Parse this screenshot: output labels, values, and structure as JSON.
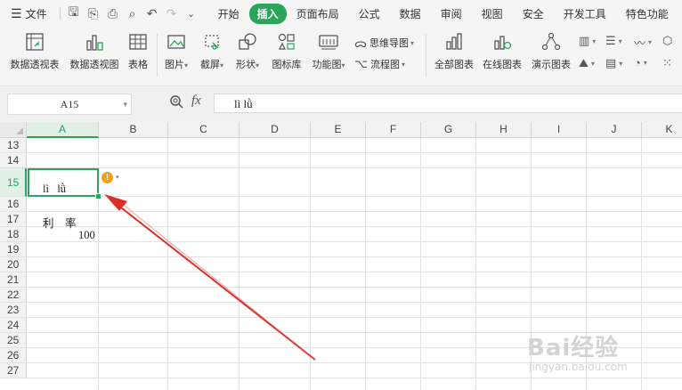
{
  "menu": {
    "file_label": "文件",
    "tabs": [
      {
        "label": "开始",
        "active": false
      },
      {
        "label": "插入",
        "active": true
      },
      {
        "label": "页面布局",
        "active": false
      },
      {
        "label": "公式",
        "active": false
      },
      {
        "label": "数据",
        "active": false
      },
      {
        "label": "审阅",
        "active": false
      },
      {
        "label": "视图",
        "active": false
      },
      {
        "label": "安全",
        "active": false
      },
      {
        "label": "开发工具",
        "active": false
      },
      {
        "label": "特色功能",
        "active": false
      }
    ]
  },
  "ribbon": {
    "pivot_table": "数据透视表",
    "pivot_chart": "数据透视图",
    "table": "表格",
    "picture": "图片",
    "screenshot": "截屏",
    "shape": "形状",
    "icon_lib": "图标库",
    "function_chart": "功能图",
    "mind_map": "思维导图",
    "flow_chart": "流程图",
    "all_charts": "全部图表",
    "online_chart": "在线图表",
    "demo_chart": "演示图表"
  },
  "formula_bar": {
    "name_box": "A15",
    "fx_label": "fx",
    "content": "lì   lǜ"
  },
  "sheet": {
    "columns": [
      "A",
      "B",
      "C",
      "D",
      "E",
      "F",
      "G",
      "H",
      "I",
      "J",
      "K"
    ],
    "selected_column": "A",
    "rows": [
      "13",
      "14",
      "15",
      "16",
      "17",
      "18",
      "19",
      "20",
      "21",
      "22",
      "23",
      "24",
      "25",
      "26",
      "27"
    ],
    "selected_row": "15",
    "cells": {
      "A15": "lì   lǜ",
      "A17": "利    率",
      "A18": "100"
    }
  },
  "watermark": {
    "text": "Bai经验",
    "sub": "jingyan.baidu.com"
  },
  "colors": {
    "accent": "#2ba55c",
    "arrow": "#d9302c",
    "warning": "#f0a020"
  }
}
